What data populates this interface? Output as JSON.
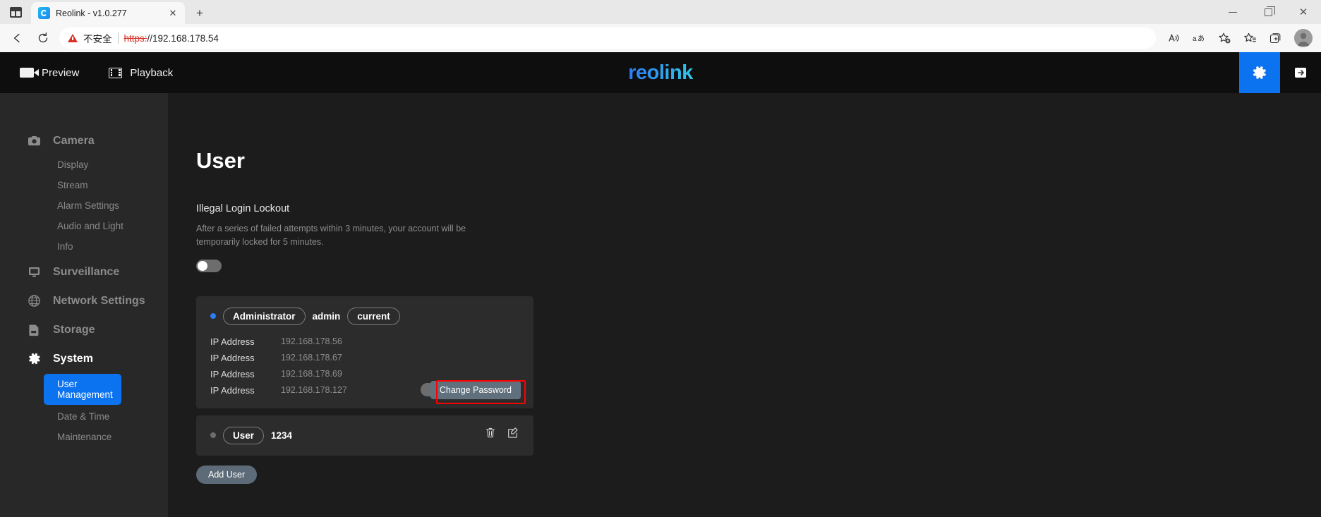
{
  "browser": {
    "tab": {
      "title": "Reolink - v1.0.277",
      "favicon": "reolink-favicon",
      "close_label": "✕"
    },
    "new_tab_label": "+",
    "window_controls": {
      "minimize": "minimize-icon",
      "maximize": "maximize-icon",
      "close": "✕"
    },
    "nav": {
      "back": "←",
      "reload": "⟳"
    },
    "omnibox": {
      "security_warning": "不安全",
      "scheme": "https:",
      "host": "//192.168.178.54"
    },
    "toolbar_icons": [
      "read-aloud-icon",
      "translate-icon",
      "add-favorite-icon",
      "favorites-icon",
      "collections-icon",
      "profile-avatar"
    ]
  },
  "app_header": {
    "nav": [
      {
        "label": "Preview",
        "icon": "video-camera-icon"
      },
      {
        "label": "Playback",
        "icon": "film-strip-icon"
      }
    ],
    "logo": "reolink",
    "settings_icon": "gear-icon",
    "logout_icon": "logout-arrow-icon",
    "accent_blue": "#0b72f0"
  },
  "sidebar": {
    "groups": [
      {
        "label": "Camera",
        "icon": "camera-icon",
        "active": false,
        "items": [
          {
            "label": "Display",
            "selected": false
          },
          {
            "label": "Stream",
            "selected": false
          },
          {
            "label": "Alarm Settings",
            "selected": false
          },
          {
            "label": "Audio and Light",
            "selected": false
          },
          {
            "label": "Info",
            "selected": false
          }
        ]
      },
      {
        "label": "Surveillance",
        "icon": "monitor-icon",
        "active": false,
        "items": []
      },
      {
        "label": "Network Settings",
        "icon": "globe-icon",
        "active": false,
        "items": []
      },
      {
        "label": "Storage",
        "icon": "sdcard-icon",
        "active": false,
        "items": []
      },
      {
        "label": "System",
        "icon": "gear-icon",
        "active": true,
        "items": [
          {
            "label": "User Management",
            "selected": true
          },
          {
            "label": "Date & Time",
            "selected": false
          },
          {
            "label": "Maintenance",
            "selected": false
          }
        ]
      }
    ]
  },
  "main": {
    "title": "User",
    "lockout": {
      "label": "Illegal Login Lockout",
      "description": "After a series of failed attempts within 3 minutes, your account will be temporarily locked for 5 minutes.",
      "enabled": false
    },
    "users": [
      {
        "role": "Administrator",
        "username": "admin",
        "badge": "current",
        "status_color": "#2b7cf6",
        "ip_rows": [
          {
            "label": "IP Address",
            "value": "192.168.178.56"
          },
          {
            "label": "IP Address",
            "value": "192.168.178.67"
          },
          {
            "label": "IP Address",
            "value": "192.168.178.69"
          },
          {
            "label": "IP Address",
            "value": "192.168.178.127"
          }
        ],
        "change_password_label": "Change Password",
        "highlighted": true
      },
      {
        "role": "User",
        "username": "1234",
        "badge": "",
        "status_color": "#6d6d6d",
        "ip_rows": [],
        "actions": [
          {
            "icon": "trash-icon",
            "name": "delete-user-button"
          },
          {
            "icon": "edit-icon",
            "name": "edit-user-button"
          }
        ]
      }
    ],
    "add_user_label": "Add User",
    "highlight_color": "#ff0000"
  }
}
